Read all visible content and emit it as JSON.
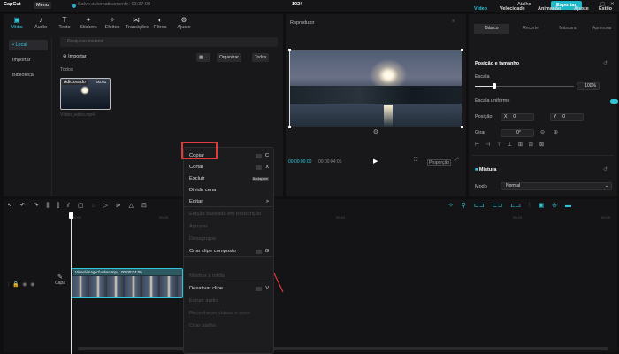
{
  "app": {
    "logo": "CapCut",
    "menu_label": "Menu",
    "autosave": "Salvo automaticamente: 03:37:00",
    "title": "1024",
    "shortcut": "Atalho",
    "export": "Exportar"
  },
  "toolbar": [
    {
      "name": "media",
      "icon": "▣",
      "label": "Mídia"
    },
    {
      "name": "audio",
      "icon": "♪",
      "label": "Áudio"
    },
    {
      "name": "text",
      "icon": "T",
      "label": "Texto"
    },
    {
      "name": "stickers",
      "icon": "✦",
      "label": "Stickers"
    },
    {
      "name": "effects",
      "icon": "✧",
      "label": "Efeitos"
    },
    {
      "name": "transitions",
      "icon": "⋈",
      "label": "Transições"
    },
    {
      "name": "filters",
      "icon": "◐",
      "label": "Filtros"
    },
    {
      "name": "adjust",
      "icon": "⚙",
      "label": "Ajuste"
    }
  ],
  "sidebar": {
    "items": [
      "• Local",
      "Importar",
      "Biblioteca"
    ]
  },
  "media": {
    "search_placeholder": "Pesquisar material",
    "import": "Importar",
    "organize": "Organizar",
    "all": "Todos",
    "section": "Todos",
    "thumb_tag": "Adicionado",
    "thumb_duration": "00:01",
    "thumb_name": "Vídeo_video.mp4"
  },
  "player": {
    "title": "Reprodutor",
    "time_current": "00:00:00:00",
    "time_total": "00:00:04:05",
    "ratio": "Proporção"
  },
  "props": {
    "tabs": [
      "Vídeo",
      "Velocidade",
      "Animação",
      "Ajuste",
      "Estilo"
    ],
    "subtabs": [
      "Básico",
      "Recorte",
      "Máscara",
      "Aprimorar"
    ],
    "section_pos": "Posição e tamanho",
    "scale": "Escala",
    "scale_value": "100%",
    "uniform_scale": "Escala uniforme",
    "position": "Posição",
    "pos_x": "0",
    "pos_y": "0",
    "rotate": "Girar",
    "rotate_value": "0°",
    "blend": "Mistura",
    "mode": "Modo",
    "mode_value": "Normal"
  },
  "timeline": {
    "ruler": [
      "00:00",
      "00:05",
      "00:10",
      "00:15",
      "00:20"
    ],
    "cover": "Capa",
    "clip_name": "Video\\image1\\video.mp4",
    "clip_dur": "00:00:04:05"
  },
  "context_menu": {
    "items": [
      {
        "label": "Copiar",
        "key": "C",
        "dim": false
      },
      {
        "label": "Cortar",
        "key": "X",
        "dim": false
      },
      {
        "label": "Excluir",
        "key": "Backspace",
        "dim": false
      },
      {
        "label": "Dividir cena",
        "key": "",
        "dim": false
      },
      {
        "label": "Editar",
        "key": ">",
        "dim": false
      },
      {
        "label": "Edição baseada em transcrição",
        "key": "",
        "dim": true
      },
      {
        "label": "Agrupar",
        "key": "",
        "dim": true
      },
      {
        "label": "Desagrupar",
        "key": "",
        "dim": true
      },
      {
        "label": "Criar clipe composto",
        "key": "G",
        "dim": false
      },
      {
        "label": "",
        "key": "",
        "dim": true
      },
      {
        "label": "Mostrar a mídia",
        "key": "",
        "dim": true
      },
      {
        "label": "Desativar clipe",
        "key": "V",
        "dim": false
      },
      {
        "label": "Extrair áudio",
        "key": "",
        "dim": true
      },
      {
        "label": "Reconhecer vídeos e sons",
        "key": "",
        "dim": true
      },
      {
        "label": "Criar atalho",
        "key": "",
        "dim": true
      }
    ]
  },
  "colors": {
    "accent": "#1fb8c9",
    "highlight": "#e03a3a"
  }
}
